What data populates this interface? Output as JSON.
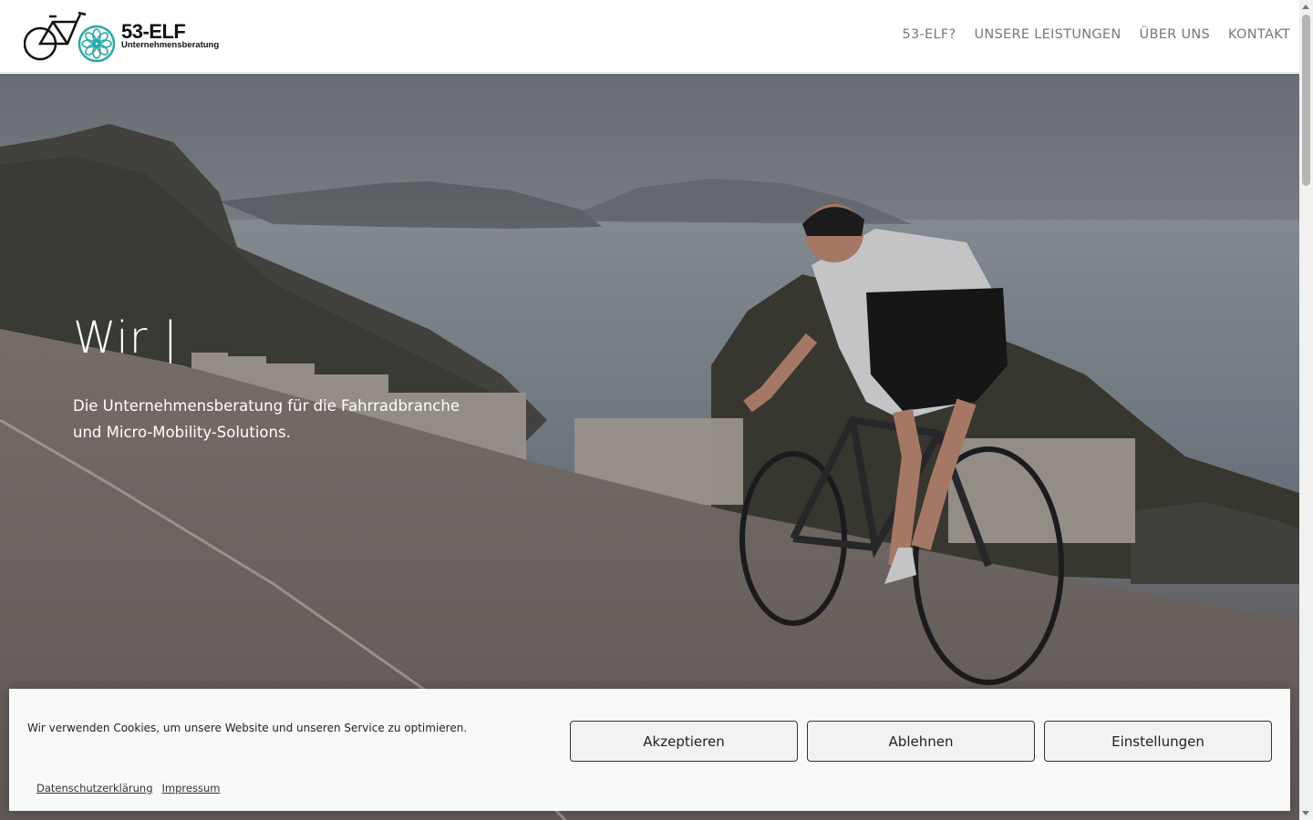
{
  "header": {
    "logo": {
      "name": "53-ELF",
      "subtitle": "Unternehmensberatung",
      "icon": "bicycle-flower-logo"
    },
    "nav": [
      "53-ELF?",
      "UNSERE LEISTUNGEN",
      "ÜBER UNS",
      "KONTAKT"
    ]
  },
  "hero": {
    "title": "Wir |",
    "subtitle": "Die Unternehmensberatung für die Fahrradbranche und Micro-Mobility-Solutions.",
    "image": "cyclist-on-coastal-road"
  },
  "cookie_banner": {
    "message": "Wir verwenden Cookies, um unsere Website und unseren Service zu optimieren.",
    "buttons": {
      "accept": "Akzeptieren",
      "decline": "Ablehnen",
      "settings": "Einstellungen"
    },
    "links": {
      "privacy": "Datenschutzerklärung",
      "imprint": "Impressum"
    }
  },
  "colors": {
    "accent": "#2aa8a8",
    "banner_bg": "#f9f9f9",
    "nav_text": "#777777"
  }
}
